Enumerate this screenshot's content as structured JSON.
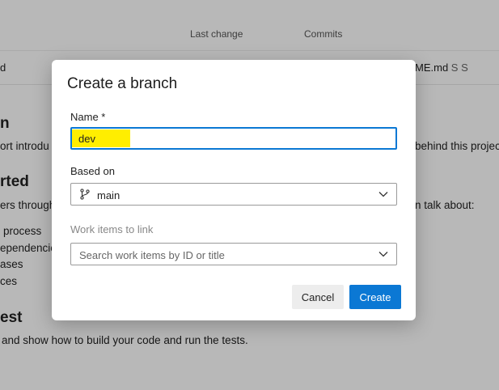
{
  "background": {
    "columns": {
      "last_change": "Last change",
      "commits": "Commits"
    },
    "row": {
      "left_fragment": "d",
      "file_fragment": "ME.md",
      "file_suffix": "S S"
    },
    "sections": [
      {
        "heading": "n",
        "text": "ort introdu",
        "text_right": "behind this project"
      },
      {
        "heading": "rted",
        "text": "ers through",
        "text_right": "n talk about:"
      }
    ],
    "list_items": [
      "process",
      "ependencie",
      "ases",
      "ces"
    ],
    "last_heading": "est",
    "last_text": "and show how to build your code and run the tests."
  },
  "dialog": {
    "title": "Create a branch",
    "name_label": "Name *",
    "name_value": "dev",
    "based_on_label": "Based on",
    "based_on_value": "main",
    "work_items_label": "Work items to link",
    "work_items_placeholder": "Search work items by ID or title",
    "cancel_label": "Cancel",
    "create_label": "Create"
  },
  "colors": {
    "accent": "#0b78d4",
    "highlight": "#ffee00"
  }
}
